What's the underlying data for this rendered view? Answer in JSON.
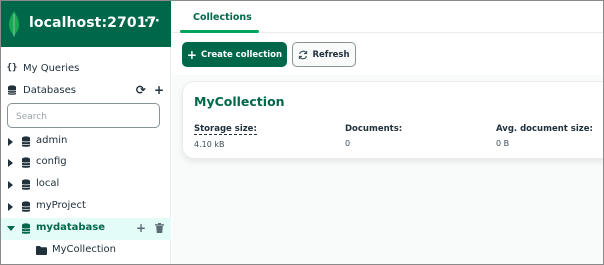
{
  "connection": {
    "title": "localhost:27017",
    "menu_label": "···"
  },
  "sidebar": {
    "my_queries_label": "My Queries",
    "databases_label": "Databases",
    "search_placeholder": "Search",
    "databases": [
      {
        "name": "admin",
        "expanded": false
      },
      {
        "name": "config",
        "expanded": false
      },
      {
        "name": "local",
        "expanded": false
      },
      {
        "name": "myProject",
        "expanded": false
      },
      {
        "name": "mydatabase",
        "expanded": true,
        "active": true
      }
    ],
    "collections": [
      {
        "name": "MyCollection"
      }
    ]
  },
  "tabs": [
    {
      "label": "Collections",
      "active": true
    }
  ],
  "toolbar": {
    "create_label": "Create collection",
    "refresh_label": "Refresh"
  },
  "collection_card": {
    "title": "MyCollection",
    "stats": [
      {
        "label": "Storage size:",
        "value": "4.10 kB"
      },
      {
        "label": "Documents:",
        "value": "0"
      },
      {
        "label": "Avg. document size:",
        "value": "0 B"
      }
    ]
  },
  "colors": {
    "brand_green": "#00684a",
    "accent_green": "#00a35c",
    "active_row_bg": "#e3fcf7",
    "text": "#21313c"
  }
}
